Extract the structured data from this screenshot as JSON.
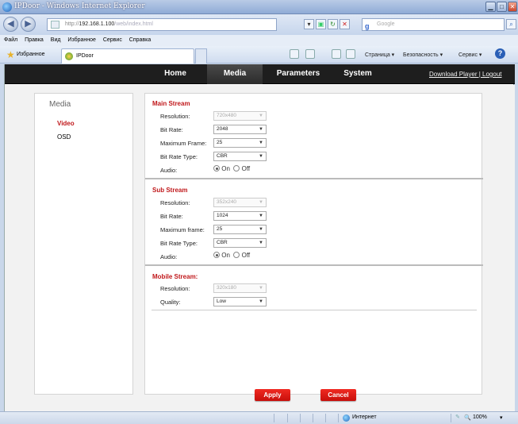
{
  "window": {
    "title": "IPDoor - Windows Internet Explorer",
    "min_glyph": "▁",
    "max_glyph": "□",
    "close_glyph": "✕"
  },
  "address": {
    "proto": "http://",
    "host": "192.168.1.100",
    "path": "/web/index.html",
    "search_placeholder": "Google",
    "search_logo": "g"
  },
  "menu": [
    "Файл",
    "Правка",
    "Вид",
    "Избранное",
    "Сервис",
    "Справка"
  ],
  "favorites": {
    "label": "Избранное",
    "tab_label": "IPDoor"
  },
  "commands": {
    "page": "Страница ▾",
    "security": "Безопасность ▾",
    "tools": "Сервис ▾",
    "help": "?"
  },
  "nav": {
    "items": [
      "Home",
      "Media",
      "Parameters",
      "System"
    ],
    "active": "Media",
    "download": "Download Player",
    "separator": " | ",
    "logout": "Logout"
  },
  "left_panel": {
    "title": "Media",
    "items": [
      "Video",
      "OSD"
    ],
    "active": "Video"
  },
  "main_stream": {
    "title": "Main Stream",
    "resolution_label": "Resolution:",
    "resolution": "720x480",
    "bitrate_label": "Bit Rate:",
    "bitrate": "2048",
    "maxframe_label": "Maximum Frame:",
    "maxframe": "25",
    "ratetype_label": "Bit Rate Type:",
    "ratetype": "CBR",
    "audio_label": "Audio:",
    "on": "On",
    "off": "Off",
    "audio_selected": "On"
  },
  "sub_stream": {
    "title": "Sub Stream",
    "resolution_label": "Resolution:",
    "resolution": "352x240",
    "bitrate_label": "Bit Rate:",
    "bitrate": "1024",
    "maxframe_label": "Maximum frame:",
    "maxframe": "25",
    "ratetype_label": "Bit Rate Type:",
    "ratetype": "CBR",
    "audio_label": "Audio:",
    "on": "On",
    "off": "Off",
    "audio_selected": "On"
  },
  "mobile_stream": {
    "title": "Mobile Stream:",
    "resolution_label": "Resolution:",
    "resolution": "320x180",
    "quality_label": "Quality:",
    "quality": "Low"
  },
  "buttons": {
    "apply": "Apply",
    "cancel": "Cancel"
  },
  "status": {
    "zone": "Интернет",
    "zoom": "100%",
    "zoom_icon": "🔍",
    "zoom_arrow": "▾"
  },
  "colors": {
    "accent_red": "#c0181b",
    "button_red": "#e41e18",
    "nav_bg": "#1e1e1e"
  }
}
